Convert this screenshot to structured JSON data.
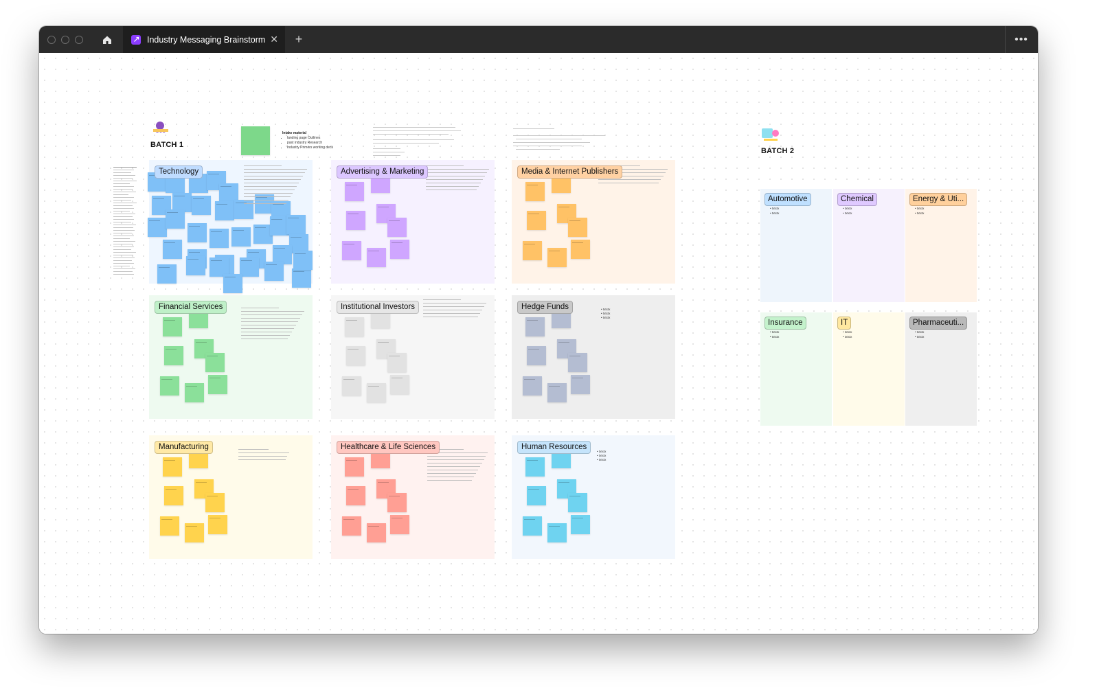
{
  "tab": {
    "title": "Industry Messaging Brainstorm",
    "close": "✕",
    "new": "+",
    "more": "•••",
    "app_icon": "figma-slides-icon"
  },
  "home_icon": "home-icon",
  "batch1": {
    "label": "BATCH 1",
    "intake_title": "Intake material",
    "intake_items": [
      "landing page Outlines",
      "past industry Research",
      "Industry Primers working deck"
    ],
    "sections": [
      {
        "id": "technology",
        "label": "Technology",
        "bg": "#eef6ff",
        "chip": "#bfdcff",
        "sticky": "#7fc0f7",
        "count": 34
      },
      {
        "id": "advertising",
        "label": "Advertising & Marketing",
        "bg": "#f6f1ff",
        "chip": "#dcc7ff",
        "sticky": "#cfa6ff",
        "count": 10
      },
      {
        "id": "media",
        "label": "Media & Internet Publishers",
        "bg": "#fff3e8",
        "chip": "#ffd1a3",
        "sticky": "#ffc266",
        "count": 8
      },
      {
        "id": "financial",
        "label": "Financial Services",
        "bg": "#eefaf0",
        "chip": "#bff0c8",
        "sticky": "#8be09a",
        "count": 8
      },
      {
        "id": "institutional",
        "label": "Institutional Investors",
        "bg": "#f6f6f6",
        "chip": "#e6e6e6",
        "sticky": "#e2e2e2",
        "count": 8
      },
      {
        "id": "hedge",
        "label": "Hedge Funds",
        "bg": "#eeeeee",
        "chip": "#c9c9c9",
        "sticky": "#b4bdd2",
        "count": 8
      },
      {
        "id": "manufacturing",
        "label": "Manufacturing",
        "bg": "#fffbea",
        "chip": "#ffe9a6",
        "sticky": "#ffd34d",
        "count": 8
      },
      {
        "id": "healthcare",
        "label": "Healthcare & Life Sciences",
        "bg": "#fff2f0",
        "chip": "#ffc7c0",
        "sticky": "#ff9f94",
        "count": 8
      },
      {
        "id": "hr",
        "label": "Human Resources",
        "bg": "#f2f7fd",
        "chip": "#c5e4fb",
        "sticky": "#6fd3f0",
        "count": 8
      }
    ],
    "hedge_items": [
      "txtxtx",
      "txtxtx",
      "txtxtx"
    ],
    "hr_items": [
      "txtxtx",
      "txtxtx",
      "txtxtx"
    ]
  },
  "batch2": {
    "label": "BATCH 2",
    "columns": [
      {
        "id": "automotive",
        "label": "Automotive",
        "bg": "#eef5fc",
        "chip": "#bfe0ff",
        "items": [
          "txtxtx",
          "txtxtx"
        ]
      },
      {
        "id": "chemical",
        "label": "Chemical",
        "bg": "#f6f1fd",
        "chip": "#dfc9ff",
        "items": [
          "txtxtx",
          "txtxtx"
        ]
      },
      {
        "id": "energy",
        "label": "Energy & Uti...",
        "bg": "#fff3e8",
        "chip": "#ffd09c",
        "items": [
          "txtxtx",
          "txtxtx"
        ]
      },
      {
        "id": "insurance",
        "label": "Insurance",
        "bg": "#eefaf0",
        "chip": "#c4f2cc",
        "items": [
          "txtxtx",
          "txtxtx"
        ]
      },
      {
        "id": "it",
        "label": "IT",
        "bg": "#fffbea",
        "chip": "#ffe8a0",
        "items": [
          "txtxtx",
          "txtxtx"
        ]
      },
      {
        "id": "pharma",
        "label": "Pharmaceuti...",
        "bg": "#efefef",
        "chip": "#b9b9b9",
        "items": [
          "txtxtx",
          "txtxtx"
        ]
      }
    ]
  }
}
